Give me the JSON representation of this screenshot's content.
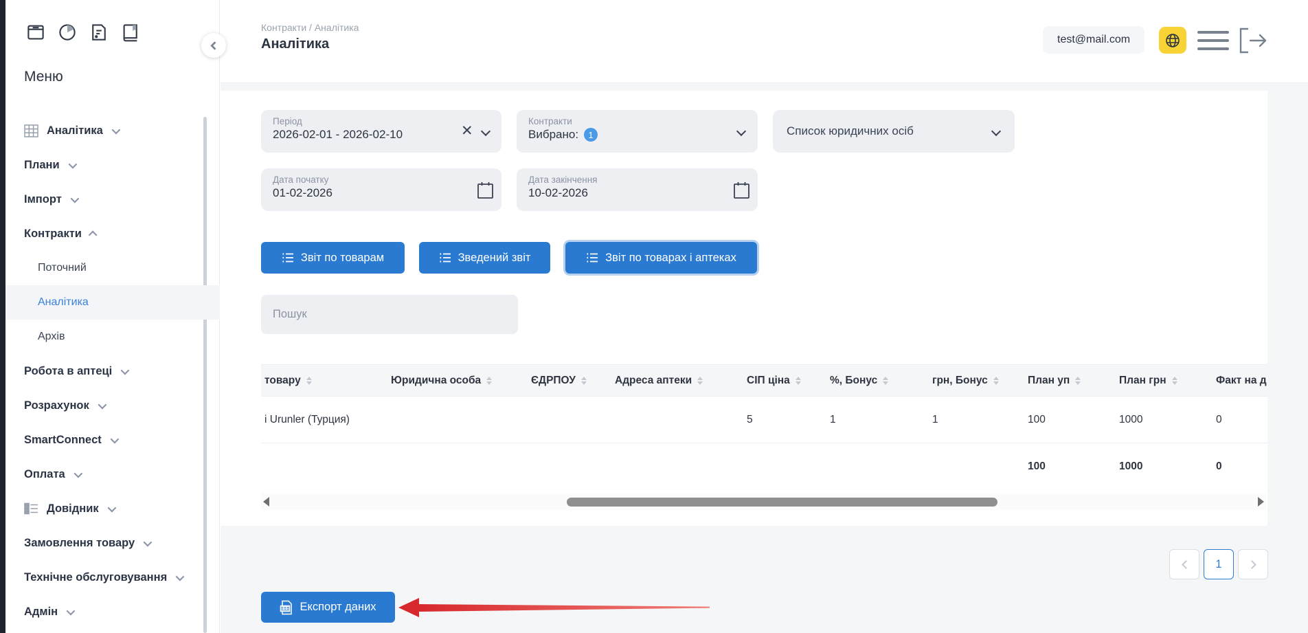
{
  "sidebar": {
    "title": "Меню",
    "top_icons": [
      "archive-icon",
      "pie-chart-icon",
      "document-icon",
      "book-icon"
    ],
    "items": [
      {
        "label": "Аналітика"
      },
      {
        "label": "Плани"
      },
      {
        "label": "Імпорт"
      },
      {
        "label": "Контракти"
      },
      {
        "label": "Поточний"
      },
      {
        "label": "Аналітика"
      },
      {
        "label": "Архів"
      },
      {
        "label": "Робота в аптеці"
      },
      {
        "label": "Розрахунок"
      },
      {
        "label": "SmartConnect"
      },
      {
        "label": "Оплата"
      },
      {
        "label": "Довідник"
      },
      {
        "label": "Замовлення товару"
      },
      {
        "label": "Технічне обслуговування"
      },
      {
        "label": "Адмін"
      }
    ]
  },
  "header": {
    "breadcrumb": "Контракти / Аналітика",
    "title": "Аналітика",
    "email": "test@mail.com"
  },
  "filters": {
    "period": {
      "label": "Період",
      "value": "2026-02-01 - 2026-02-10"
    },
    "contracts": {
      "label": "Контракти",
      "value": "Вибрано:",
      "badge": "1"
    },
    "legal_entities": {
      "label": "Список юридичних осіб"
    },
    "date_start": {
      "label": "Дата початку",
      "value": "01-02-2026"
    },
    "date_end": {
      "label": "Дата закінчення",
      "value": "10-02-2026"
    }
  },
  "reports": {
    "by_products": "Звіт по товарам",
    "summary": "Зведений звіт",
    "by_products_pharmacies": "Звіт по товарах і аптеках"
  },
  "search": {
    "placeholder": "Пошук"
  },
  "table": {
    "columns": [
      "товару",
      "Юридична особа",
      "ЄДРПОУ",
      "Адреса аптеки",
      "СІП ціна",
      "%, Бонус",
      "грн, Бонус",
      "План уп",
      "План грн",
      "Факт на д"
    ],
    "row": {
      "product": "i Urunler (Турция)",
      "legal_entity": "",
      "edrpou": "",
      "address": "",
      "sip_price": "5",
      "bonus_pct": "1",
      "bonus_uah": "1",
      "plan_units": "100",
      "plan_uah": "1000",
      "fact": "0"
    },
    "totals": {
      "plan_units": "100",
      "plan_uah": "1000",
      "fact": "0"
    }
  },
  "pagination": {
    "page": "1"
  },
  "export": {
    "label": "Експорт даних"
  },
  "colors": {
    "accent": "#2b7ad2",
    "active_link": "#3b82d8",
    "badge": "#4a9ae8",
    "globe_bg": "#f7d335",
    "arrow_red": "#e0312f"
  }
}
